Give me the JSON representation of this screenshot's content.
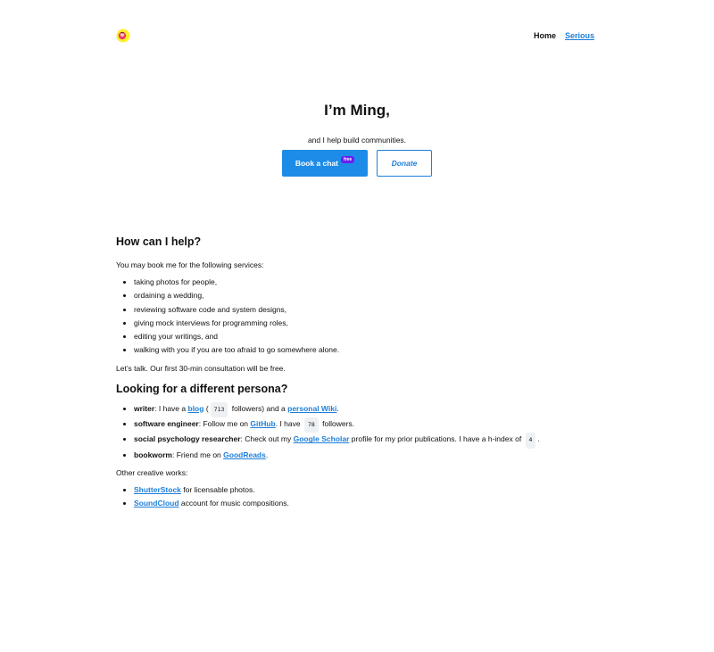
{
  "header": {
    "logo_icon": "avatar-icon",
    "nav": {
      "home": "Home",
      "serious": "Serious"
    }
  },
  "hero": {
    "title": "I’m Ming,",
    "subtitle": "and I help build communities.",
    "book_label": "Book a chat",
    "book_badge": "free",
    "donate_label": "Donate"
  },
  "help": {
    "heading": "How can I help?",
    "intro": "You may book me for the following services:",
    "services": [
      "taking photos for people,",
      "ordaining a wedding,",
      "reviewing software code and system designs,",
      "giving mock interviews for programming roles,",
      "editing your writings, and",
      "walking with you if you are too afraid to go somewhere alone."
    ],
    "outro": "Let’s talk. Our first 30-min consultation will be free."
  },
  "persona": {
    "heading": "Looking for a different persona?",
    "writer": {
      "role": "writer",
      "t1": ": I have a ",
      "link1": "blog",
      "t2": " (",
      "count": "713",
      "t3": " followers) and a ",
      "link2": "personal Wiki",
      "t4": "."
    },
    "engineer": {
      "role": "software engineer",
      "t1": ": Follow me on ",
      "link1": "GitHub",
      "t2": ". I have ",
      "count": "78",
      "t3": " followers."
    },
    "researcher": {
      "role": "social psychology researcher",
      "t1": ": Check out my ",
      "link1": "Google Scholar",
      "t2": " profile for my prior publications. I have a h-index of ",
      "count": "4",
      "t3": "."
    },
    "bookworm": {
      "role": "bookworm",
      "t1": ": Friend me on ",
      "link1": "GoodReads",
      "t2": "."
    }
  },
  "creative": {
    "intro": "Other creative works:",
    "items": [
      {
        "link": "ShutterStock",
        "text": " for licensable photos."
      },
      {
        "link": "SoundCloud",
        "text": " account for music compositions."
      }
    ]
  }
}
